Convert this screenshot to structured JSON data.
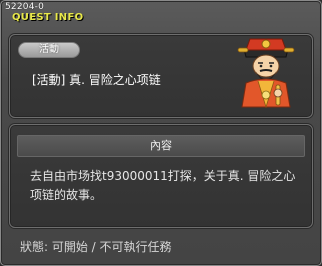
{
  "window": {
    "quest_id": "52204-0",
    "title": "QUEST INFO"
  },
  "quest": {
    "badge": "活動",
    "name": "[活動] 真. 冒险之心项链"
  },
  "content": {
    "header": "內容",
    "description": "去自由市场找t93000011打探，关于真. 冒险之心项链的故事。"
  },
  "footer": {
    "status": "狀態:  可開始  / 不可執行任務"
  },
  "npc": {
    "icon": "npc-official-portrait-icon"
  }
}
